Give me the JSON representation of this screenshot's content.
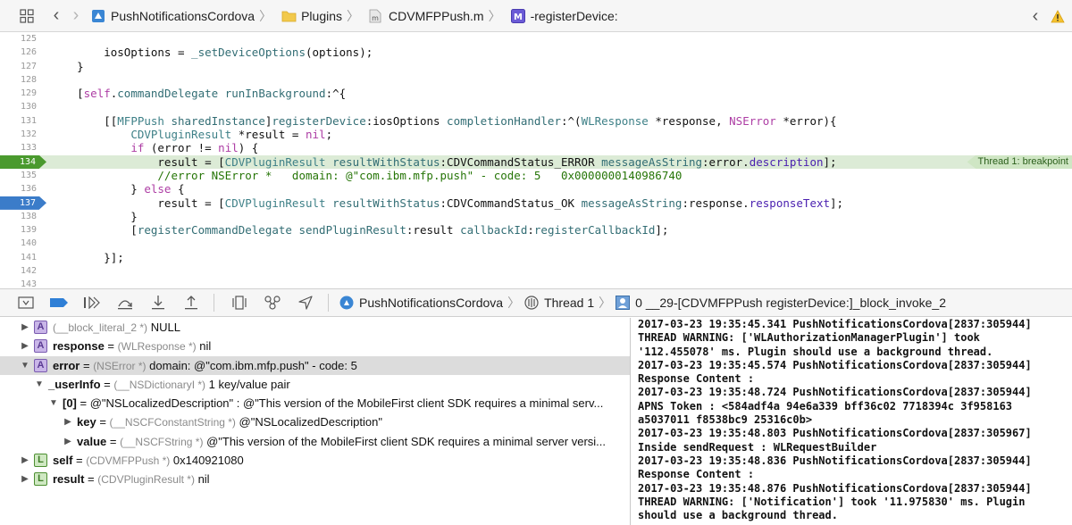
{
  "jumpbar": {
    "crumbs": [
      {
        "label": "PushNotificationsCordova",
        "icon": "xcode-project-icon"
      },
      {
        "label": "Plugins",
        "icon": "folder-icon"
      },
      {
        "label": "CDVMFPPush.m",
        "icon": "objc-file-icon",
        "icon_letter": "m"
      },
      {
        "label": "-registerDevice:",
        "icon": "method-icon",
        "icon_letter": "M"
      }
    ]
  },
  "editor": {
    "lines": [
      {
        "n": "125",
        "segments": []
      },
      {
        "n": "126",
        "segments": [
          {
            "t": "        iosOptions = ",
            "c": "plain"
          },
          {
            "t": "_setDeviceOptions",
            "c": "fn"
          },
          {
            "t": "(options);",
            "c": "plain"
          }
        ]
      },
      {
        "n": "127",
        "segments": [
          {
            "t": "    }",
            "c": "plain"
          }
        ]
      },
      {
        "n": "128",
        "segments": []
      },
      {
        "n": "129",
        "segments": [
          {
            "t": "    [",
            "c": "plain"
          },
          {
            "t": "self",
            "c": "kw"
          },
          {
            "t": ".",
            "c": "plain"
          },
          {
            "t": "commandDelegate",
            "c": "fn"
          },
          {
            "t": " ",
            "c": "plain"
          },
          {
            "t": "runInBackground",
            "c": "fn"
          },
          {
            "t": ":^{",
            "c": "plain"
          }
        ]
      },
      {
        "n": "130",
        "segments": []
      },
      {
        "n": "131",
        "segments": [
          {
            "t": "        [[",
            "c": "plain"
          },
          {
            "t": "MFPPush",
            "c": "cls"
          },
          {
            "t": " ",
            "c": "plain"
          },
          {
            "t": "sharedInstance",
            "c": "fn"
          },
          {
            "t": "]",
            "c": "plain"
          },
          {
            "t": "registerDevice",
            "c": "fn"
          },
          {
            "t": ":iosOptions ",
            "c": "plain"
          },
          {
            "t": "completionHandler",
            "c": "fn"
          },
          {
            "t": ":^(",
            "c": "plain"
          },
          {
            "t": "WLResponse",
            "c": "cls"
          },
          {
            "t": " *response, ",
            "c": "plain"
          },
          {
            "t": "NSError",
            "c": "kw"
          },
          {
            "t": " *error){",
            "c": "plain"
          }
        ]
      },
      {
        "n": "132",
        "segments": [
          {
            "t": "            ",
            "c": "plain"
          },
          {
            "t": "CDVPluginResult",
            "c": "cls"
          },
          {
            "t": " *result = ",
            "c": "plain"
          },
          {
            "t": "nil",
            "c": "kw"
          },
          {
            "t": ";",
            "c": "plain"
          }
        ]
      },
      {
        "n": "133",
        "segments": [
          {
            "t": "            ",
            "c": "plain"
          },
          {
            "t": "if",
            "c": "kw"
          },
          {
            "t": " (error != ",
            "c": "plain"
          },
          {
            "t": "nil",
            "c": "kw"
          },
          {
            "t": ") {",
            "c": "plain"
          }
        ]
      },
      {
        "n": "134",
        "marker": "green",
        "highlight": true,
        "badge": "Thread 1: breakpoint",
        "segments": [
          {
            "t": "                result = [",
            "c": "plain"
          },
          {
            "t": "CDVPluginResult",
            "c": "cls"
          },
          {
            "t": " ",
            "c": "plain"
          },
          {
            "t": "resultWithStatus",
            "c": "fn"
          },
          {
            "t": ":CDVCommandStatus_ERROR ",
            "c": "plain"
          },
          {
            "t": "messageAsString",
            "c": "fn"
          },
          {
            "t": ":error.",
            "c": "plain"
          },
          {
            "t": "description",
            "c": "prop"
          },
          {
            "t": "];",
            "c": "plain"
          }
        ]
      },
      {
        "n": "135",
        "segments": [
          {
            "t": "                //error NSError *   domain: @\"com.ibm.mfp.push\" - code: 5   0x0000000140986740",
            "c": "cmt"
          }
        ]
      },
      {
        "n": "136",
        "segments": [
          {
            "t": "            } ",
            "c": "plain"
          },
          {
            "t": "else",
            "c": "kw"
          },
          {
            "t": " {",
            "c": "plain"
          }
        ]
      },
      {
        "n": "137",
        "marker": "blue",
        "segments": [
          {
            "t": "                result = [",
            "c": "plain"
          },
          {
            "t": "CDVPluginResult",
            "c": "cls"
          },
          {
            "t": " ",
            "c": "plain"
          },
          {
            "t": "resultWithStatus",
            "c": "fn"
          },
          {
            "t": ":CDVCommandStatus_OK ",
            "c": "plain"
          },
          {
            "t": "messageAsString",
            "c": "fn"
          },
          {
            "t": ":response.",
            "c": "plain"
          },
          {
            "t": "responseText",
            "c": "prop"
          },
          {
            "t": "];",
            "c": "plain"
          }
        ]
      },
      {
        "n": "138",
        "segments": [
          {
            "t": "            }",
            "c": "plain"
          }
        ]
      },
      {
        "n": "139",
        "segments": [
          {
            "t": "            [",
            "c": "plain"
          },
          {
            "t": "registerCommandDelegate",
            "c": "fn"
          },
          {
            "t": " ",
            "c": "plain"
          },
          {
            "t": "sendPluginResult",
            "c": "fn"
          },
          {
            "t": ":result ",
            "c": "plain"
          },
          {
            "t": "callbackId",
            "c": "fn"
          },
          {
            "t": ":",
            "c": "plain"
          },
          {
            "t": "registerCallbackId",
            "c": "fn"
          },
          {
            "t": "];",
            "c": "plain"
          }
        ]
      },
      {
        "n": "140",
        "segments": []
      },
      {
        "n": "141",
        "segments": [
          {
            "t": "        }];",
            "c": "plain"
          }
        ]
      },
      {
        "n": "142",
        "segments": []
      },
      {
        "n": "143",
        "segments": []
      }
    ]
  },
  "debugbar": {
    "process": "PushNotificationsCordova",
    "thread": "Thread 1",
    "frame": "0 __29-[CDVMFPPush registerDevice:]_block_invoke_2"
  },
  "variables": [
    {
      "indent": 0,
      "disclosure": "collapsed",
      "badge": "A",
      "name": "",
      "type": "(__block_literal_2 *)",
      "value": "NULL",
      "selected": false
    },
    {
      "indent": 0,
      "disclosure": "collapsed",
      "badge": "A",
      "name": "response",
      "type": "(WLResponse *)",
      "value": "nil",
      "selected": false
    },
    {
      "indent": 0,
      "disclosure": "expanded",
      "badge": "A",
      "name": "error",
      "type": "(NSError *)",
      "value": "domain: @\"com.ibm.mfp.push\" - code: 5",
      "selected": true
    },
    {
      "indent": 1,
      "disclosure": "expanded",
      "badge": "",
      "name": "_userInfo",
      "type": "(__NSDictionaryI *)",
      "value": "1 key/value pair",
      "selected": false
    },
    {
      "indent": 2,
      "disclosure": "expanded",
      "badge": "",
      "name": "[0]",
      "type": "",
      "value": "@\"NSLocalizedDescription\" : @\"This version of the MobileFirst client SDK requires a minimal serv...",
      "selected": false
    },
    {
      "indent": 3,
      "disclosure": "collapsed",
      "badge": "",
      "name": "key",
      "type": "(__NSCFConstantString *)",
      "value": "@\"NSLocalizedDescription\"",
      "selected": false
    },
    {
      "indent": 3,
      "disclosure": "collapsed",
      "badge": "",
      "name": "value",
      "type": "(__NSCFString *)",
      "value": "@\"This version of the MobileFirst client SDK requires a minimal server versi...",
      "selected": false
    },
    {
      "indent": 0,
      "disclosure": "collapsed",
      "badge": "L",
      "name": "self",
      "type": "(CDVMFPPush *)",
      "value": "0x140921080",
      "selected": false
    },
    {
      "indent": 0,
      "disclosure": "collapsed",
      "badge": "L",
      "name": "result",
      "type": "(CDVPluginResult *)",
      "value": "nil",
      "selected": false
    }
  ],
  "console": [
    "2017-03-23 19:35:45.341 PushNotificationsCordova[2837:305944]",
    "THREAD WARNING: ['WLAuthorizationManagerPlugin'] took",
    "'112.455078' ms. Plugin should use a background thread.",
    "2017-03-23 19:35:45.574 PushNotificationsCordova[2837:305944]",
    "Response Content :",
    "2017-03-23 19:35:48.724 PushNotificationsCordova[2837:305944]",
    "APNS Token : <584adf4a 94e6a339 bff36c02 7718394c 3f958163",
    "a5037011 f8538bc9 25316c0b>",
    "2017-03-23 19:35:48.803 PushNotificationsCordova[2837:305967]",
    "Inside sendRequest : WLRequestBuilder",
    "2017-03-23 19:35:48.836 PushNotificationsCordova[2837:305944]",
    "Response Content :",
    "2017-03-23 19:35:48.876 PushNotificationsCordova[2837:305944]",
    "THREAD WARNING: ['Notification'] took '11.975830' ms. Plugin",
    "should use a background thread."
  ]
}
